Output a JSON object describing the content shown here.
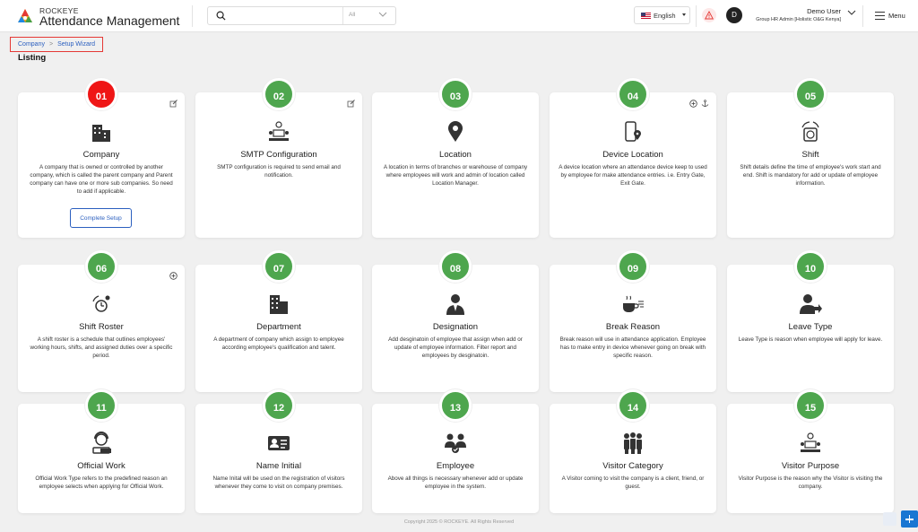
{
  "header": {
    "brand_small": "ROCKEYE",
    "brand_title": "Attendance Management",
    "search_placeholder": "",
    "search_scope": "All",
    "language": "English",
    "avatar_initial": "D",
    "user_name": "Demo User",
    "user_role": "Group HR Admin [Holistic O&G Kenya]",
    "menu_label": "Menu"
  },
  "breadcrumb": {
    "item1": "Company",
    "item2": "Setup Wizard"
  },
  "page_title": "Listing",
  "cards": [
    {
      "num": "01",
      "title": "Company",
      "desc": "A company that is owned or controlled by another company, which is called the parent company and Parent company can have one or more sub companies. So need to add if applicable.",
      "button": "Complete Setup",
      "icon": "building-icon",
      "active": true
    },
    {
      "num": "02",
      "title": "SMTP Configuration",
      "desc": "SMTP configuration is required to send email and notification.",
      "icon": "smtp-icon"
    },
    {
      "num": "03",
      "title": "Location",
      "desc": "A location in terms of branches or warehouse of company where employees will work and admin of location called Location Manager.",
      "icon": "location-pin-icon"
    },
    {
      "num": "04",
      "title": "Device Location",
      "desc": "A device location where an attendance device keep to used by employee for make attendance entries. i.e. Entry Gate, Exit Gate.",
      "icon": "device-location-icon"
    },
    {
      "num": "05",
      "title": "Shift",
      "desc": "Shift details define the time of employee's work start and end. Shift is mandatory for add or update of employee information.",
      "icon": "shift-icon"
    },
    {
      "num": "06",
      "title": "Shift Roster",
      "desc": "A shift roster is a schedule that outlines employees' working hours, shifts, and assigned duties over a specific period.",
      "icon": "shift-roster-icon"
    },
    {
      "num": "07",
      "title": "Department",
      "desc": "A department of company which assign to employee according employee's qualification and talent.",
      "icon": "department-icon"
    },
    {
      "num": "08",
      "title": "Designation",
      "desc": "Add desginatoin of employee that assign when add or update of employee information. Filter report and employees by desginatoin.",
      "icon": "designation-icon"
    },
    {
      "num": "09",
      "title": "Break Reason",
      "desc": "Break reason will use in attendance application. Employee has to make entry in device whenever going on break with specific reason.",
      "icon": "coffee-icon"
    },
    {
      "num": "10",
      "title": "Leave Type",
      "desc": "Leave Type is reason when employee will apply for leave.",
      "icon": "leave-icon"
    },
    {
      "num": "11",
      "title": "Official Work",
      "desc": "Official Work Type refers to the predefined reason an employee selects when applying for Official Work.",
      "icon": "official-work-icon"
    },
    {
      "num": "12",
      "title": "Name Initial",
      "desc": "Name Inital will be used on the registration of visitors whenever they come to visit on company premises.",
      "icon": "id-card-icon"
    },
    {
      "num": "13",
      "title": "Employee",
      "desc": "Above all things is necessary whenever add or update employee in the system.",
      "icon": "employee-icon"
    },
    {
      "num": "14",
      "title": "Visitor Category",
      "desc": "A Visitor coming to visit the company is a client, friend, or guest.",
      "icon": "visitors-icon"
    },
    {
      "num": "15",
      "title": "Visitor Purpose",
      "desc": "Visitor Purpose is the reason why the Visitor is visiting the company.",
      "icon": "meeting-icon"
    }
  ],
  "footer": "Copyright 2025 © ROCKEYE. All Rights Reserved",
  "colors": {
    "active_step": "#ef1616",
    "step": "#4ea64e",
    "link": "#2b5fbf"
  }
}
